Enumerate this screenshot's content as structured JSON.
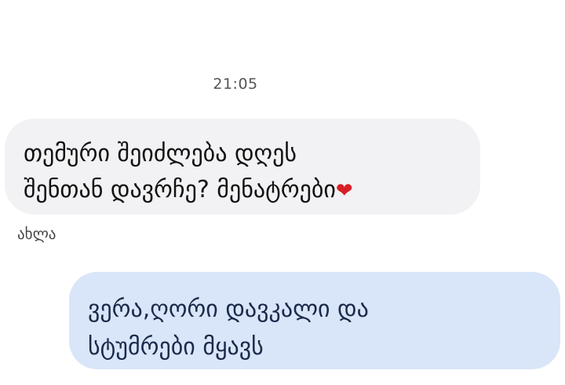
{
  "chat": {
    "timestamp": "21:05",
    "incoming": {
      "line1": "თემური შეიძლება დღეს",
      "line2": "შენთან დავრჩე? მენატრები",
      "emoji": "❤"
    },
    "incoming_status": "ახლა",
    "outgoing": {
      "line1": "ვერა,ღორი დავკალი და",
      "line2": "სტუმრები მყავს"
    }
  },
  "colors": {
    "incoming_bubble": "#f2f1f3",
    "outgoing_bubble": "#d9e5f8",
    "heart": "#d81f26"
  },
  "icons": {
    "heart": "heart-emoji-icon"
  }
}
